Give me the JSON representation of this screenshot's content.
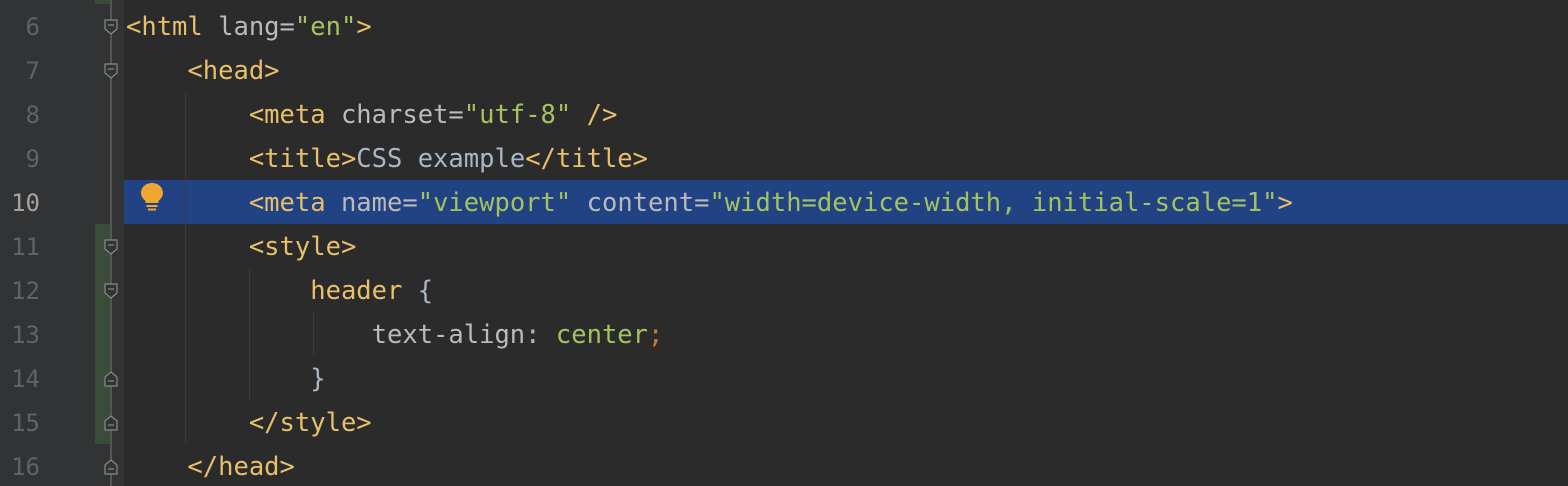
{
  "editor": {
    "current_line": 10,
    "lines": [
      {
        "number": "6",
        "tokens": [
          {
            "t": "<html ",
            "c": "tag"
          },
          {
            "t": "lang=",
            "c": "attr"
          },
          {
            "t": "\"en\"",
            "c": "val"
          },
          {
            "t": ">",
            "c": "tag"
          }
        ]
      },
      {
        "number": "7",
        "tokens": [
          {
            "t": "    ",
            "c": "txt"
          },
          {
            "t": "<head>",
            "c": "tag"
          }
        ]
      },
      {
        "number": "8",
        "tokens": [
          {
            "t": "        ",
            "c": "txt"
          },
          {
            "t": "<meta ",
            "c": "tag"
          },
          {
            "t": "charset=",
            "c": "attr"
          },
          {
            "t": "\"utf-8\"",
            "c": "val"
          },
          {
            "t": " />",
            "c": "tag"
          }
        ]
      },
      {
        "number": "9",
        "tokens": [
          {
            "t": "        ",
            "c": "txt"
          },
          {
            "t": "<title>",
            "c": "tag"
          },
          {
            "t": "CSS example",
            "c": "txt"
          },
          {
            "t": "</title>",
            "c": "tag"
          }
        ]
      },
      {
        "number": "10",
        "tokens": [
          {
            "t": "        ",
            "c": "txt"
          },
          {
            "t": "<meta ",
            "c": "tag"
          },
          {
            "t": "name=",
            "c": "attr"
          },
          {
            "t": "\"viewport\"",
            "c": "val"
          },
          {
            "t": " ",
            "c": "txt"
          },
          {
            "t": "content=",
            "c": "attr"
          },
          {
            "t": "\"width=device-width, initial-scale=1\"",
            "c": "val"
          },
          {
            "t": ">",
            "c": "tag"
          }
        ]
      },
      {
        "number": "11",
        "tokens": [
          {
            "t": "        ",
            "c": "txt"
          },
          {
            "t": "<style>",
            "c": "tag"
          }
        ]
      },
      {
        "number": "12",
        "tokens": [
          {
            "t": "            ",
            "c": "txt"
          },
          {
            "t": "header",
            "c": "sel"
          },
          {
            "t": " {",
            "c": "txt"
          }
        ]
      },
      {
        "number": "13",
        "tokens": [
          {
            "t": "                ",
            "c": "txt"
          },
          {
            "t": "text-align",
            "c": "prop"
          },
          {
            "t": ": ",
            "c": "txt"
          },
          {
            "t": "center",
            "c": "val"
          },
          {
            "t": ";",
            "c": "punc"
          }
        ]
      },
      {
        "number": "14",
        "tokens": [
          {
            "t": "            ",
            "c": "txt"
          },
          {
            "t": "}",
            "c": "txt"
          }
        ]
      },
      {
        "number": "15",
        "tokens": [
          {
            "t": "        ",
            "c": "txt"
          },
          {
            "t": "</style>",
            "c": "tag"
          }
        ]
      },
      {
        "number": "16",
        "tokens": [
          {
            "t": "    ",
            "c": "txt"
          },
          {
            "t": "</head>",
            "c": "tag"
          }
        ]
      }
    ],
    "folds": [
      {
        "line": 6,
        "kind": "open"
      },
      {
        "line": 7,
        "kind": "open"
      },
      {
        "line": 11,
        "kind": "open"
      },
      {
        "line": 12,
        "kind": "open"
      },
      {
        "line": 14,
        "kind": "close"
      },
      {
        "line": 15,
        "kind": "close"
      },
      {
        "line": 16,
        "kind": "close"
      }
    ],
    "intention_icon": "lightbulb-icon",
    "colors": {
      "background": "#2b2b2b",
      "current_line_highlight": "#214283",
      "tag": "#e8bf6a",
      "attribute": "#bababa",
      "string": "#a5c261",
      "text": "#a9b7c6",
      "line_number": "#606366",
      "lightbulb": "#f0a732"
    }
  }
}
